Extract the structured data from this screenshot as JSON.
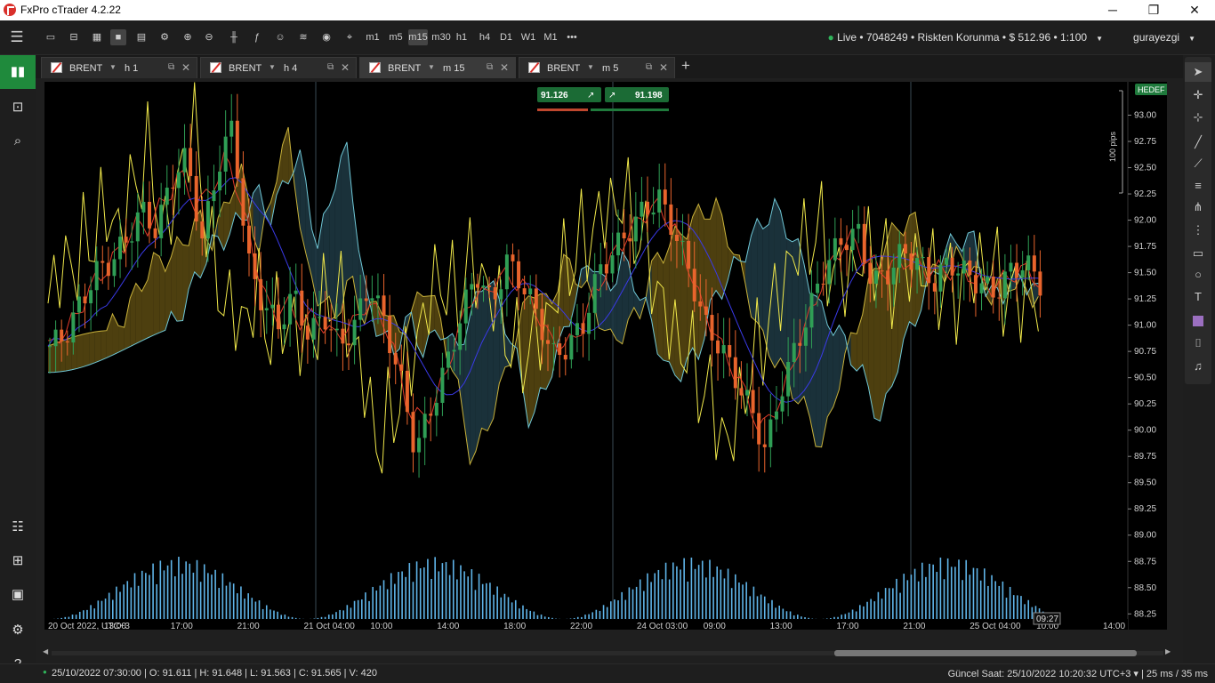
{
  "titlebar": {
    "title": "FxPro cTrader 4.2.22",
    "min": "─",
    "max": "❐",
    "close": "✕"
  },
  "toolbar": {
    "menu": "☰",
    "timeframes": [
      "m1",
      "m5",
      "m15",
      "m30",
      "h1",
      "h4",
      "D1",
      "W1",
      "M1"
    ],
    "more": "•••",
    "account": "Live • 7048249 • Riskten Korunma • $ 512.96 • 1:100",
    "account_dropdown": "▼",
    "user": "gurayezgi",
    "user_dropdown": "▼"
  },
  "tabs": [
    {
      "symbol": "BRENT",
      "tf": "h1",
      "active": false
    },
    {
      "symbol": "BRENT",
      "tf": "h4",
      "active": false
    },
    {
      "symbol": "BRENT",
      "tf": "m15",
      "active": true
    },
    {
      "symbol": "BRENT",
      "tf": "m5",
      "active": false
    }
  ],
  "tab_symbols": {
    "t0": "BRENT",
    "t1": "BRENT",
    "t2": "BRENT",
    "t3": "BRENT"
  },
  "tab_tfs": {
    "t0": "h 1",
    "t1": "h 4",
    "t2": "m 15",
    "t3": "m 5"
  },
  "trade_panel": {
    "sell": "91.12",
    "sell_sup": "6",
    "buy": "91.19",
    "buy_sup": "8",
    "sell_color": "#c0472e",
    "buy_color": "#1f7a3c"
  },
  "chart_data": {
    "type": "candlestick",
    "symbol": "BRENT",
    "timeframe": "m15",
    "price_axis": [
      "93.00",
      "92.75",
      "92.50",
      "92.25",
      "92.00",
      "91.75",
      "91.50",
      "91.25",
      "91.00",
      "90.75",
      "90.50",
      "90.25",
      "90.00",
      "89.75",
      "89.50",
      "89.25",
      "89.00",
      "88.75",
      "88.50",
      "88.25"
    ],
    "ylim": [
      88.1,
      93.25
    ],
    "time_axis": [
      "20 Oct 2022, UTC+3",
      "13:00",
      "17:00",
      "21:00",
      "21 Oct 04:00",
      "10:00",
      "14:00",
      "18:00",
      "22:00",
      "24 Oct 03:00",
      "09:00",
      "13:00",
      "17:00",
      "21:00",
      "25 Oct 04:00",
      "10:00",
      "14:00"
    ],
    "current_time_label": "09:27",
    "target_label": "HEDEF",
    "pips_label": "100 pips",
    "close_series": [
      90.8,
      90.9,
      91.2,
      91.5,
      91.6,
      91.8,
      92.1,
      91.9,
      92.4,
      92.6,
      91.8,
      92.5,
      92.9,
      91.6,
      91.2,
      91.0,
      91.3,
      90.9,
      91.1,
      90.8,
      91.0,
      91.4,
      91.0,
      90.5,
      89.8,
      90.2,
      90.6,
      91.1,
      91.5,
      91.2,
      91.6,
      91.4,
      91.1,
      90.7,
      90.8,
      91.0,
      91.5,
      91.7,
      91.9,
      92.1,
      92.2,
      91.9,
      91.5,
      91.0,
      90.8,
      90.5,
      90.2,
      89.8,
      90.4,
      90.8,
      91.2,
      91.6,
      91.8,
      91.9,
      91.4,
      91.5,
      91.7,
      91.6,
      91.4,
      91.6,
      91.5,
      91.4,
      91.3,
      91.5,
      91.6,
      91.4
    ],
    "cloud_color_bull": "#5a4a12",
    "cloud_color_bear": "#1e3a44",
    "vertical_separators": 3
  },
  "statusbar": {
    "left": "25/10/2022 07:30:00 | O: 91.611 | H: 91.648 | L: 91.563 | C: 91.565 | V: 420",
    "right": "Güncel Saat:  25/10/2022 10:20:32   UTC+3   ▾   |  25 ms / 35 ms"
  }
}
